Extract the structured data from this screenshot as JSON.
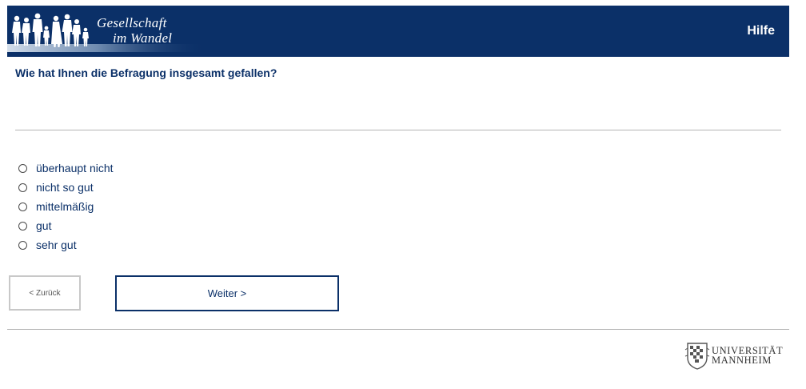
{
  "header": {
    "brand_line1": "Gesellschaft",
    "brand_line2": "im Wandel",
    "help_label": "Hilfe",
    "background_color": "#0b3068"
  },
  "question": {
    "text": "Wie hat Ihnen die Befragung insgesamt gefallen?"
  },
  "options": [
    {
      "label": "überhaupt nicht",
      "selected": false
    },
    {
      "label": "nicht so gut",
      "selected": false
    },
    {
      "label": "mittelmäßig",
      "selected": false
    },
    {
      "label": "gut",
      "selected": false
    },
    {
      "label": "sehr gut",
      "selected": false
    }
  ],
  "navigation": {
    "back_label": "< Zurück",
    "next_label": "Weiter >"
  },
  "footer": {
    "university_line1": "UNIVERSITÄT",
    "university_line2": "MANNHEIM"
  }
}
